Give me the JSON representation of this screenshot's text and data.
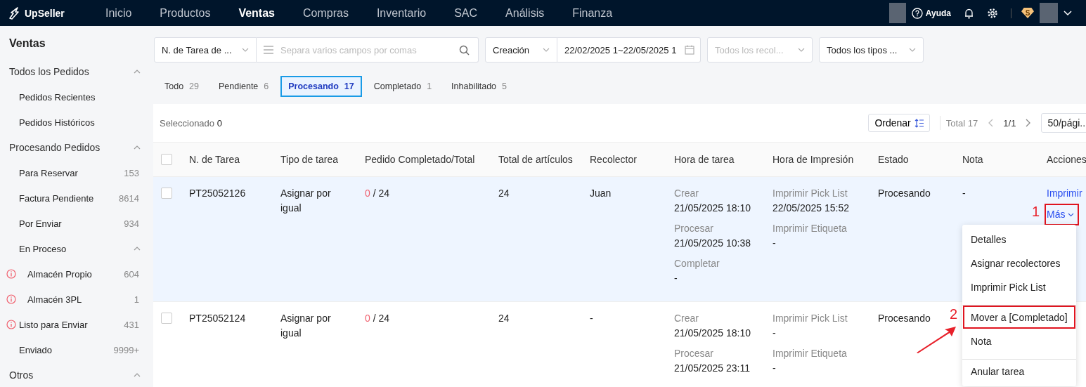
{
  "topbar": {
    "brand": "UpSeller",
    "nav": [
      {
        "label": "Inicio",
        "selected": false
      },
      {
        "label": "Productos",
        "selected": false
      },
      {
        "label": "Ventas",
        "selected": true
      },
      {
        "label": "Compras",
        "selected": false
      },
      {
        "label": "Inventario",
        "selected": false
      },
      {
        "label": "SAC",
        "selected": false
      },
      {
        "label": "Análisis",
        "selected": false
      },
      {
        "label": "Finanza",
        "selected": false
      }
    ],
    "help": "Ayuda",
    "badge": "S"
  },
  "sidebar": {
    "title": "Ventas",
    "groups": [
      {
        "label": "Todos los Pedidos",
        "expanded": true,
        "children": [
          {
            "label": "Pedidos Recientes",
            "warning": false
          },
          {
            "label": "Pedidos Históricos",
            "warning": false
          }
        ]
      },
      {
        "label": "Procesando Pedidos",
        "expanded": true,
        "children": [
          {
            "label": "Para Reservar",
            "count": "153",
            "warning": false
          },
          {
            "label": "Factura Pendiente",
            "count": "8614",
            "warning": false
          },
          {
            "label": "Por Enviar",
            "count": "934",
            "warning": false
          },
          {
            "label": "En Proceso",
            "expanded": true,
            "warning": false,
            "children": [
              {
                "label": "Almacén Propio",
                "count": "604",
                "warning": true
              },
              {
                "label": "Almacén 3PL",
                "count": "1",
                "warning": true
              }
            ]
          },
          {
            "label": "Listo para Enviar",
            "count": "431",
            "warning": true
          },
          {
            "label": "Enviado",
            "count": "9999+",
            "warning": false
          }
        ]
      },
      {
        "label": "Otros",
        "expanded": true
      }
    ]
  },
  "filters": {
    "field_select": "N. de Tarea de ...",
    "search": {
      "placeholder": "Separa varios campos por comas"
    },
    "date_type": "Creación",
    "date_range": "22/02/2025 1~22/05/2025 1",
    "collector": {
      "placeholder": "Todos los recol..."
    },
    "types": "Todos los tipos ..."
  },
  "tabs": [
    {
      "label": "Todo",
      "count": "29",
      "selected": false
    },
    {
      "label": "Pendiente",
      "count": "6",
      "selected": false
    },
    {
      "label": "Procesando",
      "count": "17",
      "selected": true
    },
    {
      "label": "Completado",
      "count": "1",
      "selected": false
    },
    {
      "label": "Inhabilitado",
      "count": "5",
      "selected": false
    }
  ],
  "toolbar": {
    "selected_label": "Seleccionado",
    "selected_count": "0",
    "sort": "Ordenar",
    "total": "Total 17",
    "page": "1/1",
    "page_size": "50/pági..."
  },
  "table": {
    "select_all": {
      "checked": false
    },
    "columns": [
      "N. de Tarea",
      "Tipo de tarea",
      "Pedido Completado/Total",
      "Total de artículos",
      "Recolector",
      "Hora de tarea",
      "Hora de Impresión",
      "Estado",
      "Nota",
      "Acciones"
    ],
    "rows": [
      {
        "checked": false,
        "highlighted": true,
        "task": "PT25052126",
        "type": "Asignar por igual",
        "done": "0",
        "total": "/ 24",
        "items": "24",
        "collector": "Juan",
        "times": [
          {
            "label": "Crear",
            "value": "21/05/2025 18:10"
          },
          {
            "label": "Procesar",
            "value": "21/05/2025 10:38"
          },
          {
            "label": "Completar",
            "value": "-"
          }
        ],
        "prints": [
          {
            "label": "Imprimir Pick List",
            "value": "22/05/2025 15:52"
          },
          {
            "label": "Imprimir Etiqueta",
            "value": "-"
          }
        ],
        "status": "Procesando",
        "note": "-",
        "actions": [
          "Imprimir",
          "Más"
        ]
      },
      {
        "checked": false,
        "highlighted": false,
        "task": "PT25052124",
        "type": "Asignar por igual",
        "done": "0",
        "total": "/ 24",
        "items": "24",
        "collector": "-",
        "times": [
          {
            "label": "Crear",
            "value": "21/05/2025 18:10"
          },
          {
            "label": "Procesar",
            "value": "21/05/2025 23:11"
          }
        ],
        "prints": [
          {
            "label": "Imprimir Pick List",
            "value": "-"
          },
          {
            "label": "Imprimir Etiqueta",
            "value": "-"
          }
        ],
        "status": "Procesando",
        "actions": []
      }
    ]
  },
  "menu": [
    {
      "label": "Detalles",
      "divider_before": false,
      "marked": false
    },
    {
      "label": "Asignar recolectores",
      "divider_before": false,
      "marked": false
    },
    {
      "label": "Imprimir Pick List",
      "divider_before": false,
      "marked": false
    },
    {
      "label": "Mover a [Completado]",
      "divider_before": true,
      "marked": true
    },
    {
      "label": "Nota",
      "divider_before": false,
      "marked": false
    },
    {
      "label": "Anular tarea",
      "divider_before": true,
      "marked": false
    }
  ],
  "annotations": [
    "1",
    "2"
  ]
}
